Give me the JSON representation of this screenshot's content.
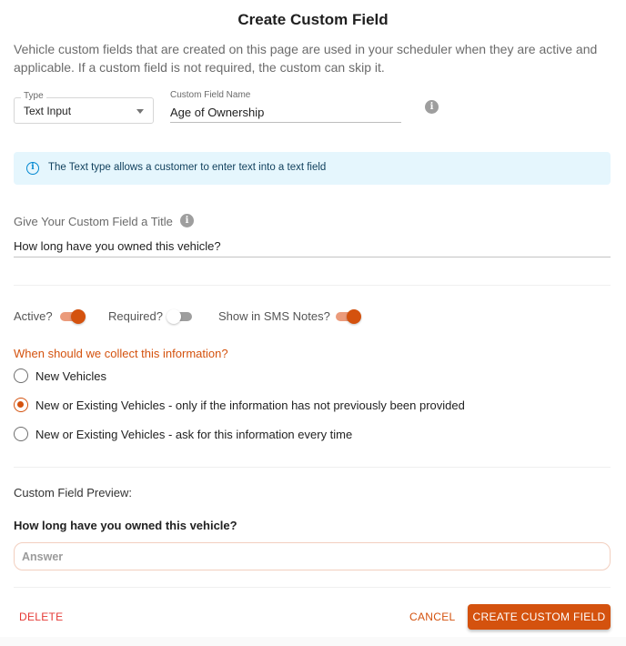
{
  "dialog": {
    "title": "Create Custom Field",
    "intro": "Vehicle custom fields that are created on this page are used in your scheduler when they are active and applicable. If a custom field is not required, the custom can skip it."
  },
  "type_select": {
    "label": "Type",
    "value": "Text Input",
    "icon": "chevron-down-icon"
  },
  "name_field": {
    "label": "Custom Field Name",
    "value": "Age of Ownership",
    "info_icon": "info-icon",
    "info_glyph": "i"
  },
  "alert": {
    "icon": "info-outline-icon",
    "glyph": "i",
    "text": "The Text type allows a customer to enter text into a text field",
    "color": "#0288d1",
    "background": "#e5f6fd"
  },
  "title_field": {
    "label": "Give Your Custom Field a Title",
    "value": "How long have you owned this vehicle?",
    "info_glyph": "i"
  },
  "toggles": [
    {
      "label": "Active?",
      "on": true
    },
    {
      "label": "Required?",
      "on": false
    },
    {
      "label": "Show in SMS Notes?",
      "on": true
    }
  ],
  "collect": {
    "question": "When should we collect this information?",
    "options": [
      {
        "label": "New Vehicles",
        "checked": false
      },
      {
        "label": "New or Existing Vehicles - only if the information has not previously been provided",
        "checked": true
      },
      {
        "label": "New or Existing Vehicles - ask for this information every time",
        "checked": false
      }
    ]
  },
  "preview": {
    "label": "Custom Field Preview:",
    "question": "How long have you owned this vehicle?",
    "placeholder": "Answer"
  },
  "actions": {
    "delete": "DELETE",
    "cancel": "CANCEL",
    "create": "CREATE CUSTOM FIELD"
  },
  "colors": {
    "accent": "#d4520e",
    "danger": "#e53935"
  }
}
